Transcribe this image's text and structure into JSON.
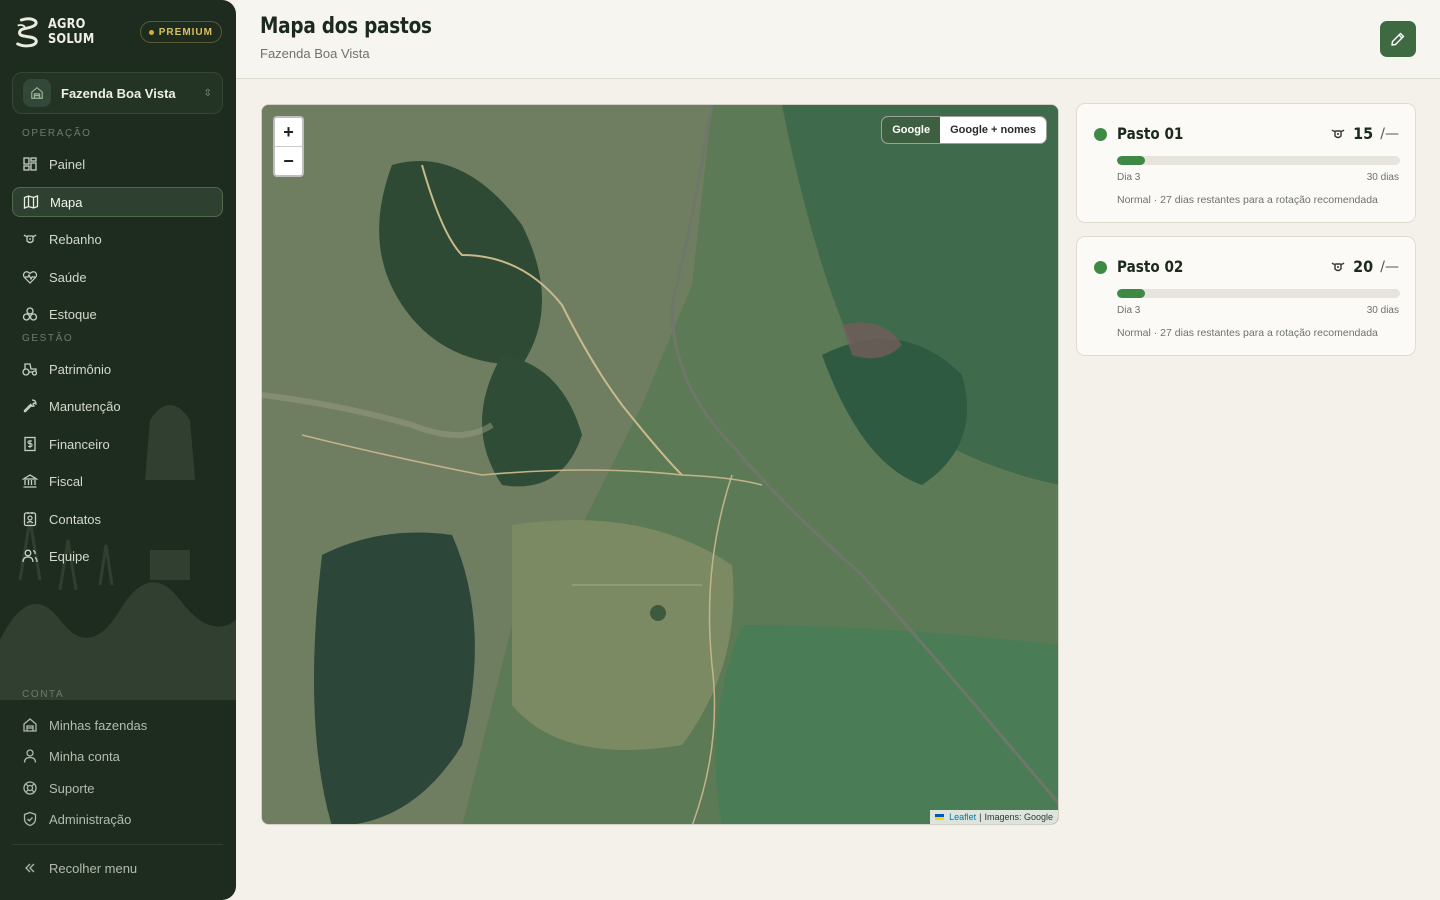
{
  "brand": {
    "name": "AGRO SOLUM",
    "badge": "PREMIUM"
  },
  "farm_selector": {
    "value": "Fazenda Boa Vista"
  },
  "sidebar": {
    "sections": {
      "operacao": "OPERAÇÃO",
      "gestao": "GESTÃO",
      "conta": "CONTA"
    },
    "items": [
      {
        "label": "Painel",
        "icon": "dashboard-icon"
      },
      {
        "label": "Mapa",
        "icon": "map-icon",
        "active": true
      },
      {
        "label": "Rebanho",
        "icon": "cattle-icon"
      },
      {
        "label": "Saúde",
        "icon": "heart-pulse-icon"
      },
      {
        "label": "Estoque",
        "icon": "boxes-icon"
      },
      {
        "label": "Patrimônio",
        "icon": "tractor-icon"
      },
      {
        "label": "Manutenção",
        "icon": "wrench-icon"
      },
      {
        "label": "Financeiro",
        "icon": "dollar-receipt-icon"
      },
      {
        "label": "Fiscal",
        "icon": "bank-icon"
      },
      {
        "label": "Contatos",
        "icon": "contact-book-icon"
      },
      {
        "label": "Equipe",
        "icon": "team-icon"
      }
    ],
    "account_items": [
      {
        "label": "Minhas fazendas",
        "icon": "farm-icon"
      },
      {
        "label": "Minha conta",
        "icon": "user-icon"
      },
      {
        "label": "Suporte",
        "icon": "lifebuoy-icon"
      },
      {
        "label": "Administração",
        "icon": "shield-check-icon"
      }
    ],
    "collapse_label": "Recolher menu"
  },
  "header": {
    "title": "Mapa dos pastos",
    "subtitle": "Fazenda Boa Vista"
  },
  "map": {
    "zoom_in": "+",
    "zoom_out": "−",
    "layers": [
      "Google",
      "Google + nomes"
    ],
    "active_layer": "Google",
    "attribution": {
      "leaflet": "Leaflet",
      "separator": "|",
      "imagery": "Imagens: Google"
    }
  },
  "pastures": [
    {
      "name": "Pasto 01",
      "count": "15",
      "capacity": "/—",
      "progress_fraction": 0.1,
      "day_label": "Dia 3",
      "total_label": "30 dias",
      "note": "Normal · 27 dias restantes para a rotação recomendada",
      "status_color": "#3e8a45"
    },
    {
      "name": "Pasto 02",
      "count": "20",
      "capacity": "/—",
      "progress_fraction": 0.1,
      "day_label": "Dia 3",
      "total_label": "30 dias",
      "note": "Normal · 27 dias restantes para a rotação recomendada",
      "status_color": "#3e8a45"
    }
  ],
  "colors": {
    "sidebar_bg": "#1e2c1f",
    "accent": "#3d6a40",
    "premium": "#d9be63"
  }
}
